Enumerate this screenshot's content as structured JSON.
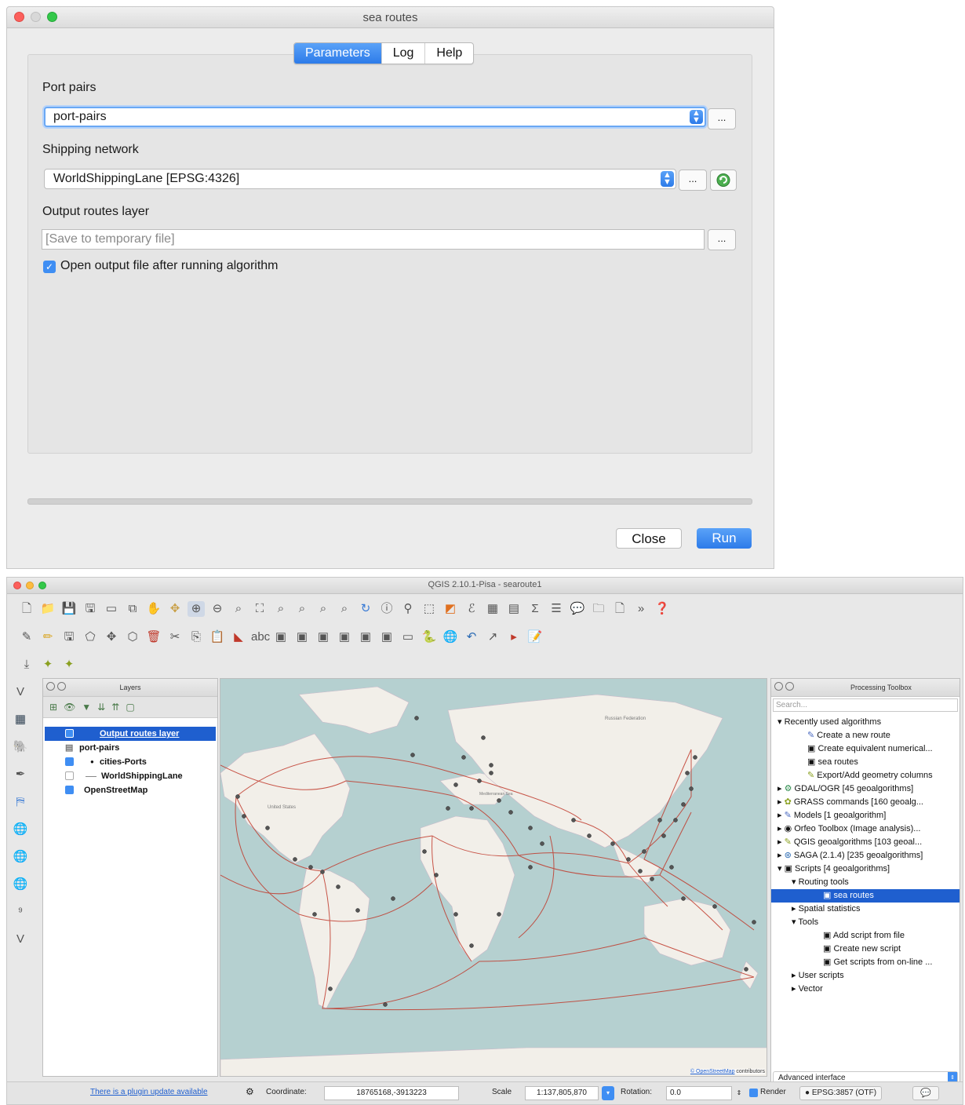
{
  "dialog": {
    "title": "sea routes",
    "tabs": [
      "Parameters",
      "Log",
      "Help"
    ],
    "port_pairs_label": "Port pairs",
    "port_pairs_value": "port-pairs",
    "shipping_label": "Shipping network",
    "shipping_value": "WorldShippingLane [EPSG:4326]",
    "output_label": "Output routes layer",
    "output_placeholder": "[Save to temporary file]",
    "browse_label": "...",
    "open_output_label": "Open output file after running algorithm",
    "open_output_checked": true,
    "close_label": "Close",
    "run_label": "Run"
  },
  "qgis": {
    "title": "QGIS 2.10.1-Pisa - searoute1",
    "layers_panel": {
      "title": "Layers",
      "items": [
        {
          "label": "Output routes layer",
          "checked": true,
          "selected": true
        },
        {
          "label": "port-pairs",
          "checked": null,
          "selected": false
        },
        {
          "label": "cities-Ports",
          "checked": true,
          "selected": false
        },
        {
          "label": "WorldShippingLane",
          "checked": false,
          "selected": false
        },
        {
          "label": "OpenStreetMap",
          "checked": true,
          "selected": false
        }
      ]
    },
    "map": {
      "attribution_link": "© OpenStreetMap",
      "attribution_rest": " contributors",
      "sea_label": "Mediterranean Sea",
      "russia_label": "Russian Federation",
      "us_label": "United States"
    },
    "toolbox": {
      "title": "Processing Toolbox",
      "search_placeholder": "Search...",
      "recent": "Recently used algorithms",
      "recent_items": [
        "Create a new route",
        "Create equivalent numerical...",
        "sea routes",
        "Export/Add geometry columns"
      ],
      "providers": [
        "GDAL/OGR [45 geoalgorithms]",
        "GRASS commands [160 geoalg...",
        "Models [1 geoalgorithm]",
        "Orfeo Toolbox (Image analysis)...",
        "QGIS geoalgorithms [103 geoal...",
        "SAGA (2.1.4) [235 geoalgorithms]",
        "Scripts [4 geoalgorithms]"
      ],
      "routing_tools": "Routing tools",
      "sea_routes": "sea routes",
      "spatial_statistics": "Spatial statistics",
      "tools": "Tools",
      "tools_items": [
        "Add script from file",
        "Create new script",
        "Get scripts from on-line ..."
      ],
      "user_scripts": "User scripts",
      "vector": "Vector",
      "interface_select": "Advanced interface"
    },
    "status": {
      "plugin_update": "There is a plugin update available",
      "coordinate_label": "Coordinate:",
      "coordinate_value": "18765168,-3913223",
      "scale_label": "Scale",
      "scale_value": "1:137,805,870",
      "rotation_label": "Rotation:",
      "rotation_value": "0.0",
      "render_label": "Render",
      "crs_label": "EPSG:3857 (OTF)"
    }
  },
  "colors": {
    "accent": "#2d7be9",
    "route": "#c0392b",
    "sea": "#b5d0d0",
    "land": "#f2efe9"
  }
}
